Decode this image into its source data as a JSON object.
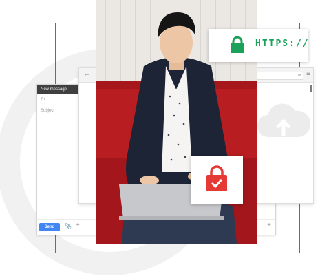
{
  "compose": {
    "title": "New message",
    "to_label": "To",
    "subject_label": "Subject",
    "send_label": "Send",
    "attach_icon": "paperclip-icon",
    "more_icon": "plus-icon"
  },
  "browser": {
    "back_icon": "back-arrow-icon",
    "menu_icon": "menu-icon",
    "cloud_icon": "cloud-icon"
  },
  "security": {
    "https_text": "HTTPS://",
    "lock_icon": "lock-icon",
    "secure_lock_icon": "lock-check-icon"
  },
  "colors": {
    "accent_red": "#e53935",
    "https_green": "#1ca15a",
    "compose_header": "#404040",
    "send_blue": "#4285f4"
  }
}
